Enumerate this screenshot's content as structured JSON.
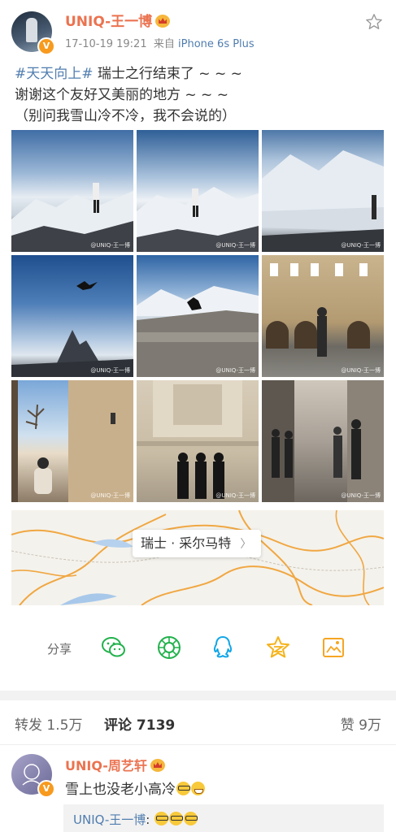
{
  "header": {
    "username": "UNIQ-王一博",
    "timestamp": "17-10-19 19:21",
    "source_prefix": "来自",
    "device": "iPhone 6s Plus",
    "verified_badge": "V"
  },
  "post": {
    "hashtag": "#天天向上#",
    "line1_rest": " 瑞士之行结束了 ~ ~ ~",
    "line2": "谢谢这个友好又美丽的地方 ~ ~ ~",
    "line3": "（别问我雪山冷不冷，我不会说的）"
  },
  "photos": [
    {
      "id": "photo-1",
      "watermark": "@UNIQ-王一博"
    },
    {
      "id": "photo-2",
      "watermark": "@UNIQ-王一博"
    },
    {
      "id": "photo-3",
      "watermark": "@UNIQ-王一博"
    },
    {
      "id": "photo-4",
      "watermark": "@UNIQ-王一博"
    },
    {
      "id": "photo-5",
      "watermark": "@UNIQ-王一博"
    },
    {
      "id": "photo-6",
      "watermark": "@UNIQ-王一博"
    },
    {
      "id": "photo-7",
      "watermark": "@UNIQ-王一博"
    },
    {
      "id": "photo-8",
      "watermark": "@UNIQ-王一博"
    },
    {
      "id": "photo-9",
      "watermark": "@UNIQ-王一博"
    }
  ],
  "location": {
    "label": "瑞士 · 采尔马特",
    "chevron": "〉"
  },
  "share": {
    "label": "分享",
    "targets": [
      "wechat-icon",
      "moments-icon",
      "qq-icon",
      "qzone-icon",
      "save-image-icon"
    ]
  },
  "tabs": {
    "repost_label": "转发",
    "repost_count": "1.5万",
    "comment_label": "评论",
    "comment_count": "7139",
    "like_label": "赞",
    "like_count": "9万"
  },
  "comment": {
    "username": "UNIQ-周艺轩",
    "text": "雪上也没老小高冷",
    "verified_badge": "V",
    "reply_user": "UNIQ-王一博",
    "reply_sep": ":"
  },
  "colors": {
    "username": "#eb7350",
    "link": "#507daf",
    "badge": "#f79a1e",
    "divider": "#f2f2f2"
  }
}
